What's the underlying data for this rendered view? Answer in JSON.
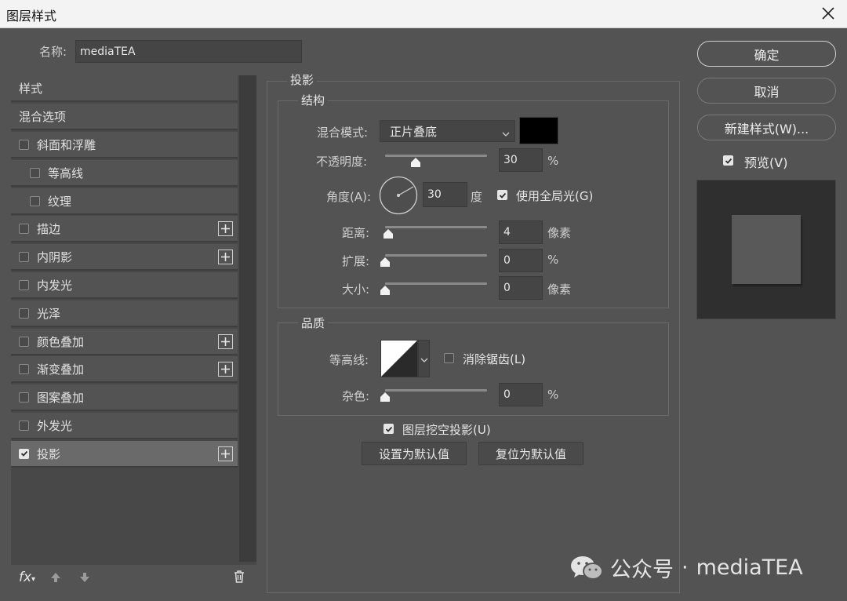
{
  "window": {
    "title": "图层样式"
  },
  "name_field": {
    "label": "名称:",
    "value": "mediaTEA"
  },
  "styles": {
    "header_styles": "样式",
    "header_blending": "混合选项",
    "items": [
      {
        "label": "斜面和浮雕",
        "checked": false,
        "indent": false,
        "has_plus": false
      },
      {
        "label": "等高线",
        "checked": false,
        "indent": true,
        "has_plus": false
      },
      {
        "label": "纹理",
        "checked": false,
        "indent": true,
        "has_plus": false
      },
      {
        "label": "描边",
        "checked": false,
        "indent": false,
        "has_plus": true
      },
      {
        "label": "内阴影",
        "checked": false,
        "indent": false,
        "has_plus": true
      },
      {
        "label": "内发光",
        "checked": false,
        "indent": false,
        "has_plus": false
      },
      {
        "label": "光泽",
        "checked": false,
        "indent": false,
        "has_plus": false
      },
      {
        "label": "颜色叠加",
        "checked": false,
        "indent": false,
        "has_plus": true
      },
      {
        "label": "渐变叠加",
        "checked": false,
        "indent": false,
        "has_plus": true
      },
      {
        "label": "图案叠加",
        "checked": false,
        "indent": false,
        "has_plus": false
      },
      {
        "label": "外发光",
        "checked": false,
        "indent": false,
        "has_plus": false
      },
      {
        "label": "投影",
        "checked": true,
        "indent": false,
        "has_plus": true,
        "selected": true
      }
    ],
    "footer": {
      "fx_label": "fx"
    }
  },
  "drop_shadow": {
    "title": "投影",
    "structure": {
      "title": "结构",
      "blend_mode_label": "混合模式:",
      "blend_mode_value": "正片叠底",
      "shadow_color": "#000000",
      "opacity_label": "不透明度:",
      "opacity_value": "30",
      "opacity_unit": "%",
      "opacity_level": 0.3,
      "angle_label": "角度(A):",
      "angle_value": "30",
      "angle_unit": "度",
      "global_light_label": "使用全局光(G)",
      "global_light_checked": true,
      "distance_label": "距离:",
      "distance_value": "4",
      "distance_unit": "像素",
      "spread_label": "扩展:",
      "spread_value": "0",
      "spread_unit": "%",
      "size_label": "大小:",
      "size_value": "0",
      "size_unit": "像素"
    },
    "quality": {
      "title": "品质",
      "contour_label": "等高线:",
      "antialias_label": "消除锯齿(L)",
      "antialias_checked": false,
      "noise_label": "杂色:",
      "noise_value": "0",
      "noise_unit": "%"
    },
    "knockout_label": "图层挖空投影(U)",
    "knockout_checked": true,
    "make_default": "设置为默认值",
    "reset_default": "复位为默认值"
  },
  "actions": {
    "ok": "确定",
    "cancel": "取消",
    "new_style": "新建样式(W)...",
    "preview_label": "预览(V)",
    "preview_checked": true
  },
  "watermark": {
    "prefix": "公众号",
    "dot": "·",
    "name": "mediaTEA"
  }
}
